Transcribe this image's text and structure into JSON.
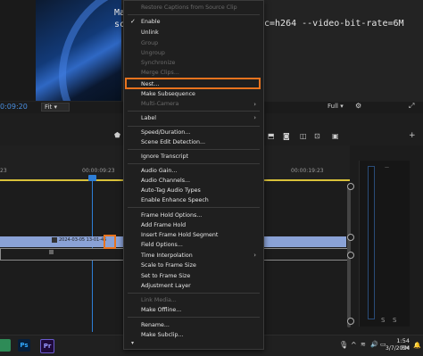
{
  "monitor": {
    "terminal_line1": "Ma",
    "terminal_line2": "sc",
    "terminal_cmd": "c=h264 --video-bit-rate=6M",
    "timecode": "0:09:20",
    "zoom": "Fit",
    "quality": "Full"
  },
  "timeline": {
    "ruler_labels": [
      "23",
      "00:00:09:23",
      "00:00:19:23"
    ],
    "clip_label": "2024-03-05 13-01-45"
  },
  "context_menu": {
    "items": [
      {
        "label": "Restore Captions from Source Clip",
        "disabled": true
      },
      {
        "label": "Enable",
        "checked": true
      },
      {
        "label": "Unlink"
      },
      {
        "label": "Group",
        "disabled": true
      },
      {
        "label": "Ungroup",
        "disabled": true
      },
      {
        "label": "Synchronize",
        "disabled": true
      },
      {
        "label": "Merge Clips...",
        "disabled": true
      },
      {
        "label": "Nest...",
        "highlighted": true
      },
      {
        "label": "Make Subsequence"
      },
      {
        "label": "Multi-Camera",
        "disabled": true,
        "submenu": true
      },
      {
        "label": "Label",
        "submenu": true
      },
      {
        "label": "Speed/Duration..."
      },
      {
        "label": "Scene Edit Detection..."
      },
      {
        "label": "Ignore Transcript"
      },
      {
        "label": "Audio Gain..."
      },
      {
        "label": "Audio Channels..."
      },
      {
        "label": "Auto-Tag Audio Types"
      },
      {
        "label": "Enable Enhance Speech"
      },
      {
        "label": "Frame Hold Options..."
      },
      {
        "label": "Add Frame Hold"
      },
      {
        "label": "Insert Frame Hold Segment"
      },
      {
        "label": "Field Options..."
      },
      {
        "label": "Time Interpolation",
        "submenu": true
      },
      {
        "label": "Scale to Frame Size"
      },
      {
        "label": "Set to Frame Size"
      },
      {
        "label": "Adjustment Layer"
      },
      {
        "label": "Link Media...",
        "disabled": true
      },
      {
        "label": "Make Offline..."
      },
      {
        "label": "Rename..."
      },
      {
        "label": "Make Subclip..."
      }
    ]
  },
  "taskbar": {
    "ps_label": "Ps",
    "pr_label": "Pr",
    "time": "1:54 PM",
    "date": "3/7/2024"
  },
  "colors": {
    "accent_blue": "#2e7ed6",
    "highlight_orange": "#e8731e",
    "clip_blue": "#8aa2d6"
  }
}
